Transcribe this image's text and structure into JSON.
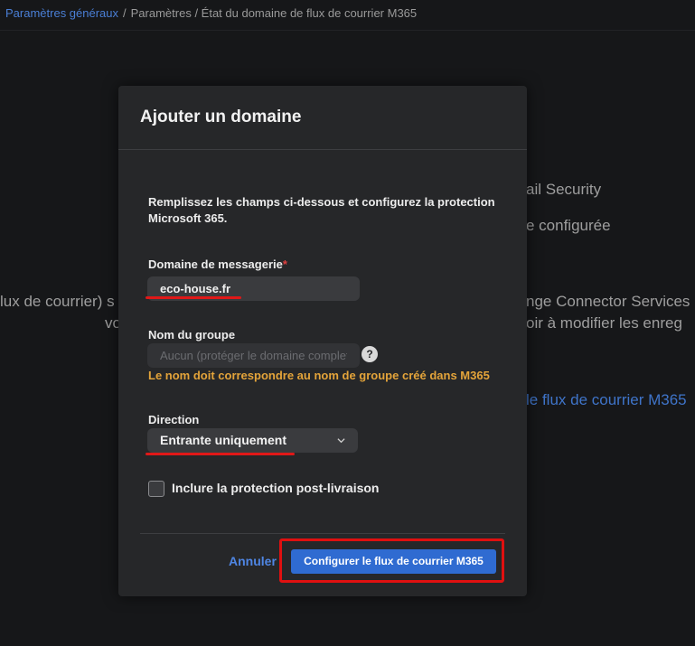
{
  "breadcrumb": {
    "root": "Paramètres généraux",
    "separator": "/",
    "rest": "Paramètres / État du domaine de flux de courrier M365"
  },
  "background": {
    "line1": "ail Security",
    "line2": "e configurée",
    "line3_left": "lux de courrier) s",
    "line3_right": "nge Connector Services",
    "line4_left": "vo",
    "line4_right": "oir à modifier les enreg",
    "link": "le flux de courrier M365"
  },
  "modal": {
    "title": "Ajouter un domaine",
    "intro": "Remplissez les champs ci-dessous et configurez la protection Microsoft 365.",
    "domain": {
      "label": "Domaine de messagerie",
      "required_mark": "*",
      "value": "eco-house.fr"
    },
    "group": {
      "label": "Nom du groupe",
      "placeholder": "Aucun (protéger le domaine complet)",
      "help_icon": "?",
      "warning": "Le nom doit correspondre au nom de groupe créé dans M365"
    },
    "direction": {
      "label": "Direction",
      "value": "Entrante uniquement"
    },
    "checkbox": {
      "label": "Inclure la protection post-livraison",
      "checked": false
    },
    "cancel_label": "Annuler",
    "submit_label": "Configurer le flux de courrier M365"
  },
  "colors": {
    "accent": "#2f6bd1",
    "warning": "#e4a43a",
    "annotation_red": "#e01010"
  },
  "icons": {
    "help": "question-circle-icon",
    "dropdown": "chevron-down-icon"
  }
}
